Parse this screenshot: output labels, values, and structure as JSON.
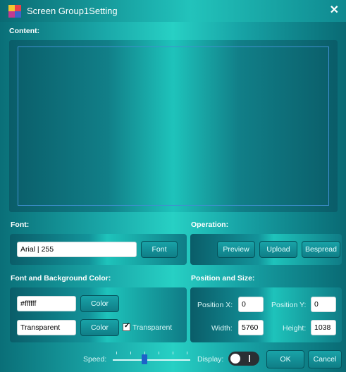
{
  "window": {
    "title": "Screen Group1Setting",
    "close_glyph": "✕"
  },
  "content": {
    "label": "Content:",
    "text": ""
  },
  "font": {
    "label": "Font:",
    "value": "Arial | 255",
    "button": "Font"
  },
  "operation": {
    "label": "Operation:",
    "preview": "Preview",
    "upload": "Upload",
    "bespread": "Bespread"
  },
  "colors": {
    "label": "Font and Background Color:",
    "font_color_value": "#ffffff",
    "font_color_button": "Color",
    "bg_color_value": "Transparent",
    "bg_color_button": "Color",
    "transparent_label": "Transparent",
    "transparent_checked": true
  },
  "position": {
    "label": "Position and Size:",
    "x_label": "Position X:",
    "x_value": "0",
    "y_label": "Position Y:",
    "y_value": "0",
    "width_label": "Width:",
    "width_value": "5760",
    "height_label": "Height:",
    "height_value": "1038"
  },
  "footer": {
    "speed_label": "Speed:",
    "display_label": "Display:",
    "ok": "OK",
    "cancel": "Cancel"
  }
}
